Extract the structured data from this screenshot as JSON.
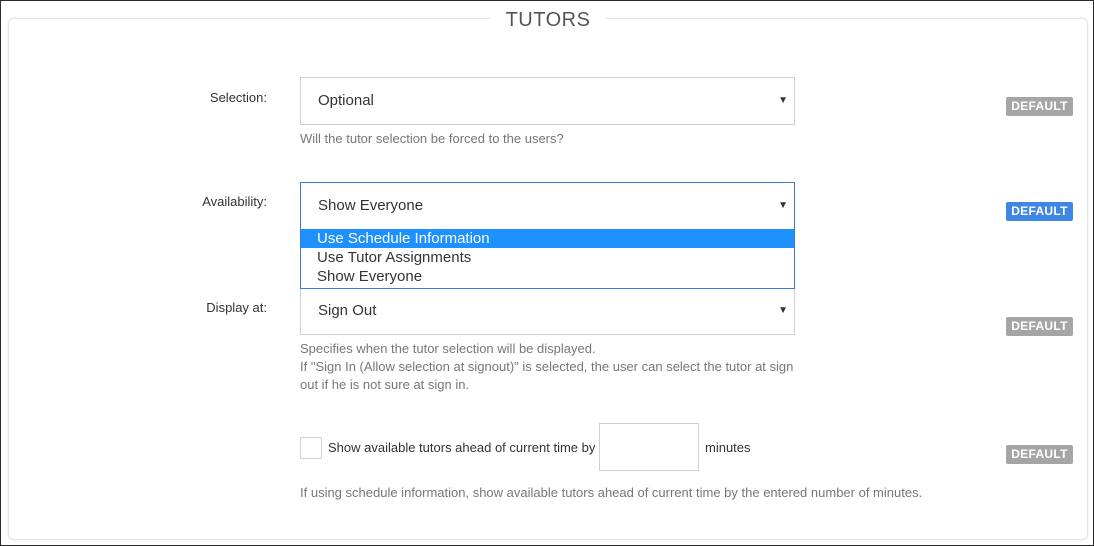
{
  "section": {
    "title": "TUTORS"
  },
  "selection": {
    "label": "Selection:",
    "value": "Optional",
    "help": "Will the tutor selection be forced to the users?",
    "default_label": "DEFAULT"
  },
  "availability": {
    "label": "Availability:",
    "value": "Show Everyone",
    "options": [
      "Use Schedule Information",
      "Use Tutor Assignments",
      "Show Everyone"
    ],
    "highlighted_option": "Use Schedule Information",
    "default_label": "DEFAULT"
  },
  "display_at": {
    "label": "Display at:",
    "value": "Sign Out",
    "help_line1": "Specifies when the tutor selection will be displayed.",
    "help_line2": "If \"Sign In (Allow selection at signout)\" is selected, the user can select the tutor at sign",
    "help_line3": "out if he is not sure at sign in.",
    "default_label": "DEFAULT"
  },
  "ahead": {
    "checkbox_label": "Show available tutors ahead of current time by",
    "minutes_value": "",
    "minutes_label": "minutes",
    "checked": false,
    "help": "If using schedule information, show available tutors ahead of current time by the entered number of minutes.",
    "default_label": "DEFAULT"
  },
  "colors": {
    "accent": "#3d7ad8",
    "highlight": "#1e90ff",
    "default_badge": "#a5a5a5",
    "active_badge": "#3f87e5"
  }
}
